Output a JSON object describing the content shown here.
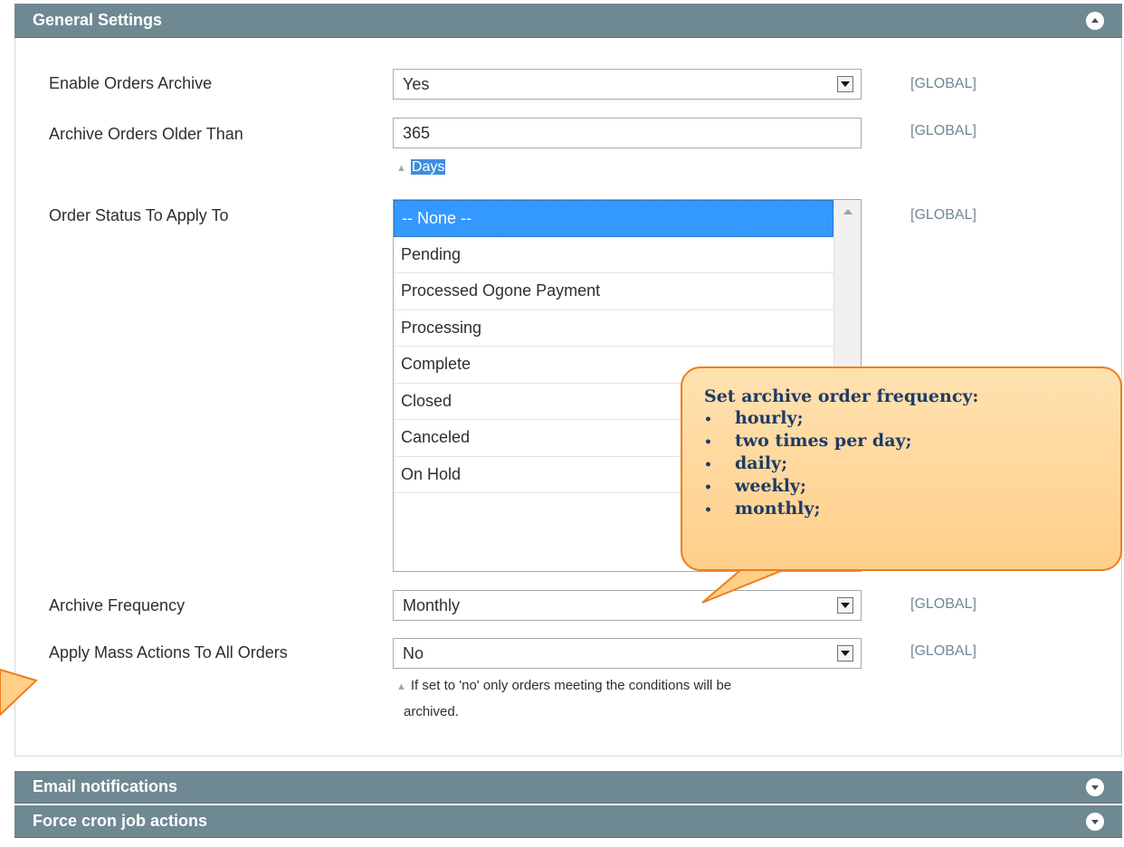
{
  "sections": {
    "general": {
      "title": "General Settings",
      "toggle_icon": "collapse-up-icon"
    },
    "email": {
      "title": "Email notifications",
      "toggle_icon": "expand-down-icon"
    },
    "cron": {
      "title": "Force cron job actions",
      "toggle_icon": "expand-down-icon"
    }
  },
  "fields": {
    "enable_archive": {
      "label": "Enable Orders Archive",
      "value": "Yes",
      "scope": "[GLOBAL]"
    },
    "archive_older": {
      "label": "Archive Orders Older Than",
      "value": "365",
      "hint": "Days",
      "scope": "[GLOBAL]"
    },
    "order_status": {
      "label": "Order Status To Apply To",
      "scope": "[GLOBAL]",
      "options": [
        "-- None --",
        "Pending",
        "Processed Ogone Payment",
        "Processing",
        "Complete",
        "Closed",
        "Canceled",
        "On Hold"
      ],
      "selected_index": 0
    },
    "archive_frequency": {
      "label": "Archive Frequency",
      "value": "Monthly",
      "scope": "[GLOBAL]"
    },
    "mass_actions": {
      "label": "Apply Mass Actions To All Orders",
      "value": "No",
      "scope": "[GLOBAL]",
      "hint_line1": "If set to 'no' only orders meeting the conditions will be",
      "hint_line2": "archived."
    }
  },
  "callout": {
    "title": "Set archive order frequency:",
    "items": [
      "hourly;",
      "two times per day;",
      "daily;",
      "weekly;",
      "monthly;"
    ]
  },
  "colors": {
    "header_bg": "#6f8992",
    "scope_text": "#6f8992",
    "selected_bg": "#3399ff",
    "callout_border": "#f07d1a",
    "callout_text": "#1f3b66"
  }
}
